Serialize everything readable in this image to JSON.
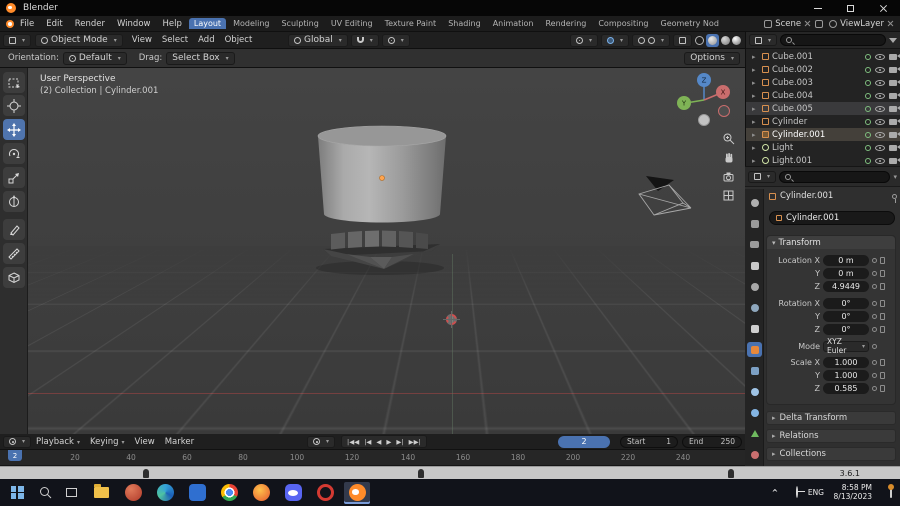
{
  "titlebar": {
    "app_title": "Blender"
  },
  "menubar": {
    "menus": [
      "File",
      "Edit",
      "Render",
      "Window",
      "Help"
    ],
    "workspaces": [
      "Layout",
      "Modeling",
      "Sculpting",
      "UV Editing",
      "Texture Paint",
      "Shading",
      "Animation",
      "Rendering",
      "Compositing",
      "Geometry Nod"
    ],
    "scene_label": "Scene",
    "viewlayer_label": "ViewLayer"
  },
  "tool_header": {
    "mode_select": "Object Mode",
    "menus": [
      "View",
      "Select",
      "Add",
      "Object"
    ],
    "orientation_select": "Global"
  },
  "tool_settings": {
    "orientation_label": "Orientation:",
    "orientation_value": "Default",
    "drag_label": "Drag:",
    "drag_value": "Select Box",
    "options_button": "Options"
  },
  "viewport": {
    "view_label": "User Perspective",
    "context_label": "(2) Collection | Cylinder.001",
    "gizmo_axes": {
      "x": "X",
      "y": "Y",
      "z": "Z"
    }
  },
  "outliner": {
    "items": [
      {
        "name": "Cube.001"
      },
      {
        "name": "Cube.002"
      },
      {
        "name": "Cube.003"
      },
      {
        "name": "Cube.004"
      },
      {
        "name": "Cube.005"
      },
      {
        "name": "Cylinder"
      },
      {
        "name": "Cylinder.001"
      },
      {
        "name": "Light"
      },
      {
        "name": "Light.001"
      }
    ]
  },
  "properties": {
    "breadcrumb_object": "Cylinder.001",
    "object_name_field": "Cylinder.001",
    "transform": {
      "title": "Transform",
      "rows": [
        {
          "label": "Location X",
          "value": "0 m"
        },
        {
          "label": "Y",
          "value": "0 m"
        },
        {
          "label": "Z",
          "value": "4.9449"
        },
        {
          "label": "Rotation X",
          "value": "0°"
        },
        {
          "label": "Y",
          "value": "0°"
        },
        {
          "label": "Z",
          "value": "0°"
        }
      ],
      "mode_label": "Mode",
      "mode_value": "XYZ Euler",
      "scale_rows": [
        {
          "label": "Scale X",
          "value": "1.000"
        },
        {
          "label": "Y",
          "value": "1.000"
        },
        {
          "label": "Z",
          "value": "0.585"
        }
      ]
    },
    "sections": {
      "delta": "Delta Transform",
      "relations": "Relations",
      "collections": "Collections"
    }
  },
  "timeline": {
    "menus": [
      "Playback",
      "Keying",
      "View",
      "Marker"
    ],
    "transport": {
      "jump_start": "|◀◀",
      "prev_key": "|◀",
      "play_rev": "◀",
      "play": "▶",
      "next_key": "▶|",
      "jump_end": "▶▶|"
    },
    "current_frame": "2",
    "start_label": "Start",
    "start_value": "1",
    "end_label": "End",
    "end_value": "250",
    "ruler_ticks": [
      "20",
      "40",
      "60",
      "80",
      "100",
      "120",
      "140",
      "160",
      "180",
      "200",
      "220",
      "240"
    ]
  },
  "statusbar": {
    "version": "3.6.1"
  },
  "taskbar": {
    "icons": [
      "start",
      "search",
      "task-view",
      "file-explorer",
      "app-red",
      "app-edge",
      "app-blue",
      "chrome",
      "firefox",
      "discord",
      "opera",
      "blender"
    ],
    "language": "ENG",
    "time": "8:58 PM",
    "date": "8/13/2023"
  }
}
